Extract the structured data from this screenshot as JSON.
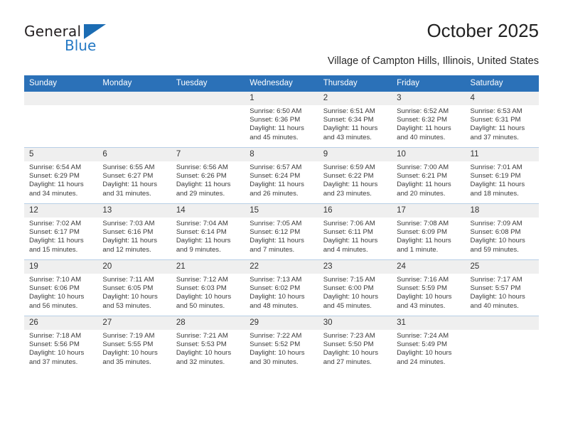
{
  "brand": {
    "name_top": "General",
    "name_bottom": "Blue",
    "triangle_icon": "triangle-icon",
    "color_blue": "#2579c4",
    "color_dark": "#231f20"
  },
  "header": {
    "title": "October 2025",
    "subtitle": "Village of Campton Hills, Illinois, United States"
  },
  "calendar": {
    "header_bg": "#2b71b8",
    "header_text_color": "#ffffff",
    "daynum_bg": "#efefef",
    "weekday_headers": [
      "Sunday",
      "Monday",
      "Tuesday",
      "Wednesday",
      "Thursday",
      "Friday",
      "Saturday"
    ],
    "weeks": [
      [
        {
          "day": "",
          "sunrise": "",
          "sunset": "",
          "daylight1": "",
          "daylight2": ""
        },
        {
          "day": "",
          "sunrise": "",
          "sunset": "",
          "daylight1": "",
          "daylight2": ""
        },
        {
          "day": "",
          "sunrise": "",
          "sunset": "",
          "daylight1": "",
          "daylight2": ""
        },
        {
          "day": "1",
          "sunrise": "Sunrise: 6:50 AM",
          "sunset": "Sunset: 6:36 PM",
          "daylight1": "Daylight: 11 hours",
          "daylight2": "and 45 minutes."
        },
        {
          "day": "2",
          "sunrise": "Sunrise: 6:51 AM",
          "sunset": "Sunset: 6:34 PM",
          "daylight1": "Daylight: 11 hours",
          "daylight2": "and 43 minutes."
        },
        {
          "day": "3",
          "sunrise": "Sunrise: 6:52 AM",
          "sunset": "Sunset: 6:32 PM",
          "daylight1": "Daylight: 11 hours",
          "daylight2": "and 40 minutes."
        },
        {
          "day": "4",
          "sunrise": "Sunrise: 6:53 AM",
          "sunset": "Sunset: 6:31 PM",
          "daylight1": "Daylight: 11 hours",
          "daylight2": "and 37 minutes."
        }
      ],
      [
        {
          "day": "5",
          "sunrise": "Sunrise: 6:54 AM",
          "sunset": "Sunset: 6:29 PM",
          "daylight1": "Daylight: 11 hours",
          "daylight2": "and 34 minutes."
        },
        {
          "day": "6",
          "sunrise": "Sunrise: 6:55 AM",
          "sunset": "Sunset: 6:27 PM",
          "daylight1": "Daylight: 11 hours",
          "daylight2": "and 31 minutes."
        },
        {
          "day": "7",
          "sunrise": "Sunrise: 6:56 AM",
          "sunset": "Sunset: 6:26 PM",
          "daylight1": "Daylight: 11 hours",
          "daylight2": "and 29 minutes."
        },
        {
          "day": "8",
          "sunrise": "Sunrise: 6:57 AM",
          "sunset": "Sunset: 6:24 PM",
          "daylight1": "Daylight: 11 hours",
          "daylight2": "and 26 minutes."
        },
        {
          "day": "9",
          "sunrise": "Sunrise: 6:59 AM",
          "sunset": "Sunset: 6:22 PM",
          "daylight1": "Daylight: 11 hours",
          "daylight2": "and 23 minutes."
        },
        {
          "day": "10",
          "sunrise": "Sunrise: 7:00 AM",
          "sunset": "Sunset: 6:21 PM",
          "daylight1": "Daylight: 11 hours",
          "daylight2": "and 20 minutes."
        },
        {
          "day": "11",
          "sunrise": "Sunrise: 7:01 AM",
          "sunset": "Sunset: 6:19 PM",
          "daylight1": "Daylight: 11 hours",
          "daylight2": "and 18 minutes."
        }
      ],
      [
        {
          "day": "12",
          "sunrise": "Sunrise: 7:02 AM",
          "sunset": "Sunset: 6:17 PM",
          "daylight1": "Daylight: 11 hours",
          "daylight2": "and 15 minutes."
        },
        {
          "day": "13",
          "sunrise": "Sunrise: 7:03 AM",
          "sunset": "Sunset: 6:16 PM",
          "daylight1": "Daylight: 11 hours",
          "daylight2": "and 12 minutes."
        },
        {
          "day": "14",
          "sunrise": "Sunrise: 7:04 AM",
          "sunset": "Sunset: 6:14 PM",
          "daylight1": "Daylight: 11 hours",
          "daylight2": "and 9 minutes."
        },
        {
          "day": "15",
          "sunrise": "Sunrise: 7:05 AM",
          "sunset": "Sunset: 6:12 PM",
          "daylight1": "Daylight: 11 hours",
          "daylight2": "and 7 minutes."
        },
        {
          "day": "16",
          "sunrise": "Sunrise: 7:06 AM",
          "sunset": "Sunset: 6:11 PM",
          "daylight1": "Daylight: 11 hours",
          "daylight2": "and 4 minutes."
        },
        {
          "day": "17",
          "sunrise": "Sunrise: 7:08 AM",
          "sunset": "Sunset: 6:09 PM",
          "daylight1": "Daylight: 11 hours",
          "daylight2": "and 1 minute."
        },
        {
          "day": "18",
          "sunrise": "Sunrise: 7:09 AM",
          "sunset": "Sunset: 6:08 PM",
          "daylight1": "Daylight: 10 hours",
          "daylight2": "and 59 minutes."
        }
      ],
      [
        {
          "day": "19",
          "sunrise": "Sunrise: 7:10 AM",
          "sunset": "Sunset: 6:06 PM",
          "daylight1": "Daylight: 10 hours",
          "daylight2": "and 56 minutes."
        },
        {
          "day": "20",
          "sunrise": "Sunrise: 7:11 AM",
          "sunset": "Sunset: 6:05 PM",
          "daylight1": "Daylight: 10 hours",
          "daylight2": "and 53 minutes."
        },
        {
          "day": "21",
          "sunrise": "Sunrise: 7:12 AM",
          "sunset": "Sunset: 6:03 PM",
          "daylight1": "Daylight: 10 hours",
          "daylight2": "and 50 minutes."
        },
        {
          "day": "22",
          "sunrise": "Sunrise: 7:13 AM",
          "sunset": "Sunset: 6:02 PM",
          "daylight1": "Daylight: 10 hours",
          "daylight2": "and 48 minutes."
        },
        {
          "day": "23",
          "sunrise": "Sunrise: 7:15 AM",
          "sunset": "Sunset: 6:00 PM",
          "daylight1": "Daylight: 10 hours",
          "daylight2": "and 45 minutes."
        },
        {
          "day": "24",
          "sunrise": "Sunrise: 7:16 AM",
          "sunset": "Sunset: 5:59 PM",
          "daylight1": "Daylight: 10 hours",
          "daylight2": "and 43 minutes."
        },
        {
          "day": "25",
          "sunrise": "Sunrise: 7:17 AM",
          "sunset": "Sunset: 5:57 PM",
          "daylight1": "Daylight: 10 hours",
          "daylight2": "and 40 minutes."
        }
      ],
      [
        {
          "day": "26",
          "sunrise": "Sunrise: 7:18 AM",
          "sunset": "Sunset: 5:56 PM",
          "daylight1": "Daylight: 10 hours",
          "daylight2": "and 37 minutes."
        },
        {
          "day": "27",
          "sunrise": "Sunrise: 7:19 AM",
          "sunset": "Sunset: 5:55 PM",
          "daylight1": "Daylight: 10 hours",
          "daylight2": "and 35 minutes."
        },
        {
          "day": "28",
          "sunrise": "Sunrise: 7:21 AM",
          "sunset": "Sunset: 5:53 PM",
          "daylight1": "Daylight: 10 hours",
          "daylight2": "and 32 minutes."
        },
        {
          "day": "29",
          "sunrise": "Sunrise: 7:22 AM",
          "sunset": "Sunset: 5:52 PM",
          "daylight1": "Daylight: 10 hours",
          "daylight2": "and 30 minutes."
        },
        {
          "day": "30",
          "sunrise": "Sunrise: 7:23 AM",
          "sunset": "Sunset: 5:50 PM",
          "daylight1": "Daylight: 10 hours",
          "daylight2": "and 27 minutes."
        },
        {
          "day": "31",
          "sunrise": "Sunrise: 7:24 AM",
          "sunset": "Sunset: 5:49 PM",
          "daylight1": "Daylight: 10 hours",
          "daylight2": "and 24 minutes."
        },
        {
          "day": "",
          "sunrise": "",
          "sunset": "",
          "daylight1": "",
          "daylight2": ""
        }
      ]
    ]
  }
}
